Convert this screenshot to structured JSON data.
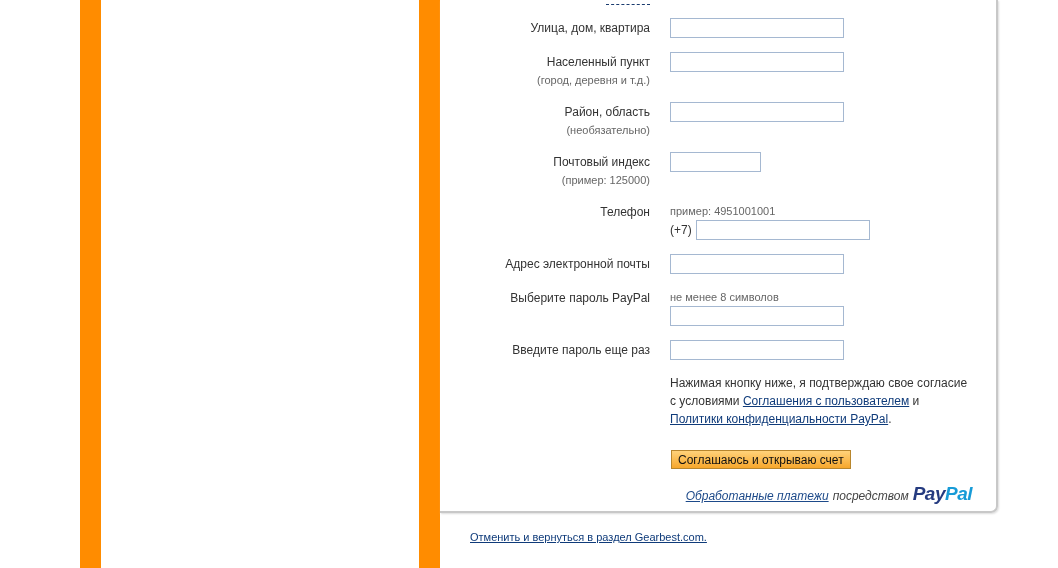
{
  "fields": [
    {
      "kind": "wide",
      "label": "Улица, дом, квартира"
    },
    {
      "kind": "wide",
      "label": "Населенный пункт",
      "note": "(город, деревня и т.д.)"
    },
    {
      "kind": "wide",
      "label": "Район, область",
      "note": "(необязательно)"
    },
    {
      "kind": "short",
      "label": "Почтовый индекс",
      "note": "(пример: 125000)"
    },
    {
      "kind": "wide",
      "label": "Телефон",
      "hint": "пример: 4951001001",
      "prefix": "(+7)"
    },
    {
      "kind": "wide",
      "label": "Адрес электронной почты"
    },
    {
      "kind": "wide",
      "label": "Выберите пароль PayPal",
      "hint": "не менее 8 символов"
    },
    {
      "kind": "wide",
      "label": "Введите пароль еще раз"
    }
  ],
  "agreement": [
    {
      "kind": "text",
      "text": "Нажимая кнопку ниже, я подтверждаю свое согласие с условиями "
    },
    {
      "kind": "link",
      "text": "Соглашения с пользователем"
    },
    {
      "kind": "text",
      "text": " и "
    },
    {
      "kind": "link",
      "text": "Политики конфиденциальности PayPal"
    },
    {
      "kind": "text",
      "text": "."
    }
  ],
  "submit_button": "Соглашаюсь и открываю счет",
  "footer": {
    "link": "Обработанные платежи",
    "text": "посредством",
    "logo": [
      "Pay",
      "Pal"
    ]
  },
  "cancel_link": "Отменить и вернуться в раздел Gearbest.com."
}
